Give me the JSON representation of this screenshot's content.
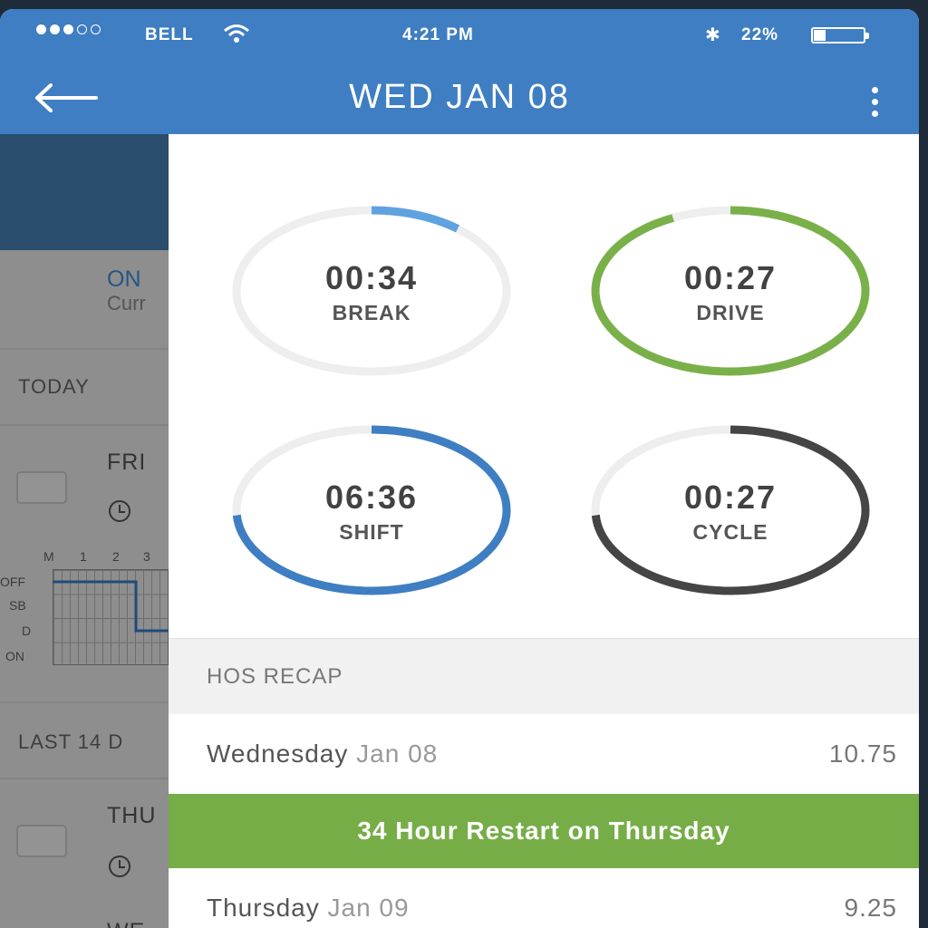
{
  "status_bar": {
    "carrier": "BELL",
    "time": "4:21 PM",
    "battery": "22%",
    "battery_level": 0.22,
    "signal_filled": 3,
    "signal_total": 5
  },
  "app_bar": {
    "title": "WED JAN 08",
    "back_icon": "arrow-left-icon",
    "menu_icon": "more-vertical-icon"
  },
  "background_list": {
    "status": "ON",
    "status_sub": "Curr",
    "today_label": "TODAY",
    "day1": "FRI",
    "grid_hours": [
      "M",
      "1",
      "2",
      "3"
    ],
    "grid_rows": [
      "OFF",
      "SB",
      "D",
      "ON"
    ],
    "last14_label": "LAST 14 D",
    "day2": "THU",
    "day3": "WE"
  },
  "gauges": [
    {
      "value": "00:34",
      "label": "BREAK",
      "progress": 0.11,
      "color": "#5ea2e0"
    },
    {
      "value": "00:27",
      "label": "DRIVE",
      "progress": 0.93,
      "color": "#7ab049"
    },
    {
      "value": "06:36",
      "label": "SHIFT",
      "progress": 0.74,
      "color": "#3f7ec2"
    },
    {
      "value": "00:27",
      "label": "CYCLE",
      "progress": 0.74,
      "color": "#454545"
    }
  ],
  "recap": {
    "header": "HOS RECAP",
    "rows": [
      {
        "weekday": "Wednesday",
        "date": "Jan 08",
        "hours": "10.75"
      },
      {
        "weekday": "Thursday",
        "date": "Jan 09",
        "hours": "9.25"
      }
    ],
    "banner": "34 Hour Restart on Thursday"
  },
  "colors": {
    "primary": "#3f7ec2",
    "green": "#76ad47",
    "track": "#eeeeee"
  }
}
